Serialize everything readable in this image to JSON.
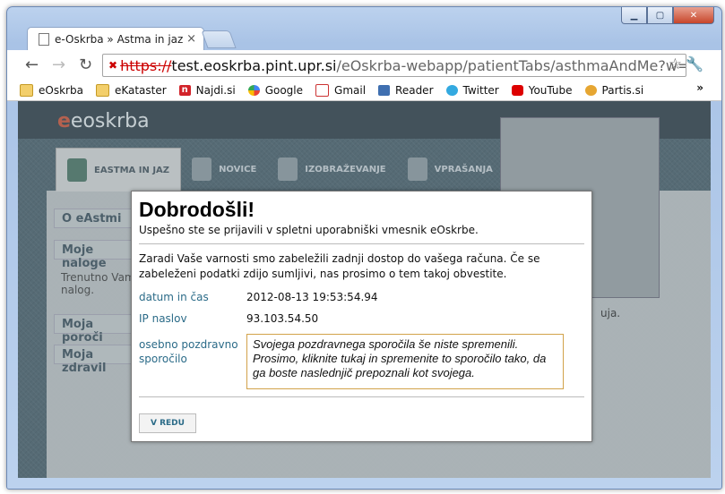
{
  "browser": {
    "tab_title": "e-Oskrba » Astma in jaz",
    "url_scheme": "https://",
    "url_host": "test.eoskrba.pint.upr.si",
    "url_path": "/eOskrba-webapp/patientTabs/asthmaAndMe?w=myTasksW"
  },
  "bookmarks": [
    {
      "label": "eOskrba",
      "icon": "folder-icon"
    },
    {
      "label": "eKataster",
      "icon": "folder-icon"
    },
    {
      "label": "Najdi.si",
      "icon": "najdi-icon"
    },
    {
      "label": "Google",
      "icon": "google-icon"
    },
    {
      "label": "Gmail",
      "icon": "gmail-icon"
    },
    {
      "label": "Reader",
      "icon": "reader-icon"
    },
    {
      "label": "Twitter",
      "icon": "twitter-icon"
    },
    {
      "label": "YouTube",
      "icon": "youtube-icon"
    },
    {
      "label": "Partis.si",
      "icon": "partis-icon"
    }
  ],
  "site": {
    "logo": "eoskrba",
    "tabs": [
      "EASTMA IN JAZ",
      "NOVICE",
      "IZOBRAŽEVANJE",
      "VPRAŠANJA"
    ],
    "side": [
      "O eAstmi",
      "Moje naloge",
      "Moja poroči",
      "Moja zdravil"
    ],
    "side_text": "Trenutno Vam nalog.",
    "right_text": "uja."
  },
  "modal": {
    "title": "Dobrodošli!",
    "subtitle": "Uspešno ste se prijavili v spletni uporabniški vmesnik eOskrbe.",
    "warning": "Zaradi Vaše varnosti smo zabeležili zadnji dostop do vašega računa. Če se zabeleženi podatki zdijo sumljivi, nas prosimo o tem takoj obvestite.",
    "date_label": "datum in čas",
    "date_value": "2012-08-13 19:53:54.94",
    "ip_label": "IP naslov",
    "ip_value": "93.103.54.50",
    "greeting_label": "osebno pozdravno sporočilo",
    "greeting_text": "Svojega pozdravnega sporočila še niste spremenili. Prosimo, kliknite tukaj in spremenite to sporočilo tako, da ga boste naslednjič prepoznali kot svojega.",
    "ok_label": "V REDU"
  }
}
